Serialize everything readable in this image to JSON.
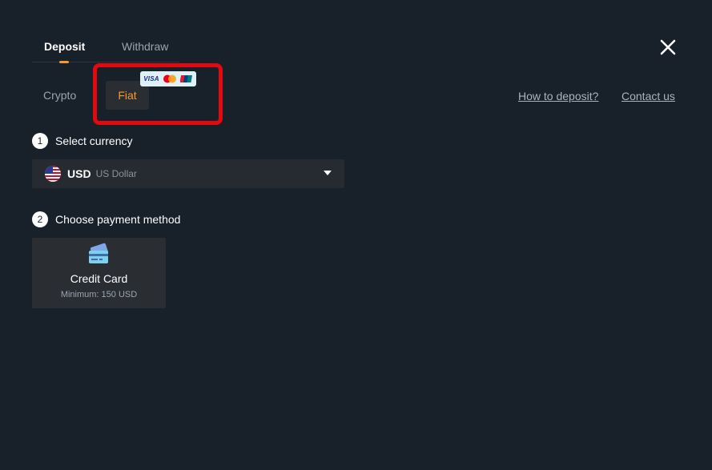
{
  "tabs": {
    "deposit": "Deposit",
    "withdraw": "Withdraw",
    "active": "Deposit"
  },
  "sub_tabs": {
    "crypto": "Crypto",
    "fiat": "Fiat",
    "active": "Fiat",
    "card_brands": [
      "visa-logo",
      "mastercard-logo",
      "unionpay-logo"
    ],
    "visa_text": "VISA"
  },
  "links": {
    "how_to_deposit": "How to deposit?",
    "contact_us": "Contact us"
  },
  "steps": {
    "step1": {
      "number": "1",
      "label": "Select currency"
    },
    "step2": {
      "number": "2",
      "label": "Choose payment method"
    }
  },
  "currency": {
    "code": "USD",
    "name": "US Dollar",
    "flag_icon": "us-flag-icon"
  },
  "payment_methods": [
    {
      "title": "Credit Card",
      "minimum": "Minimum: 150 USD",
      "icon": "credit-card-icon"
    }
  ],
  "icons": {
    "close": "close-icon",
    "dropdown": "chevron-down-icon"
  },
  "colors": {
    "background": "#18202a",
    "accent": "#f79a2c",
    "highlight": "#e4090f",
    "panel": "#2a2e33"
  }
}
